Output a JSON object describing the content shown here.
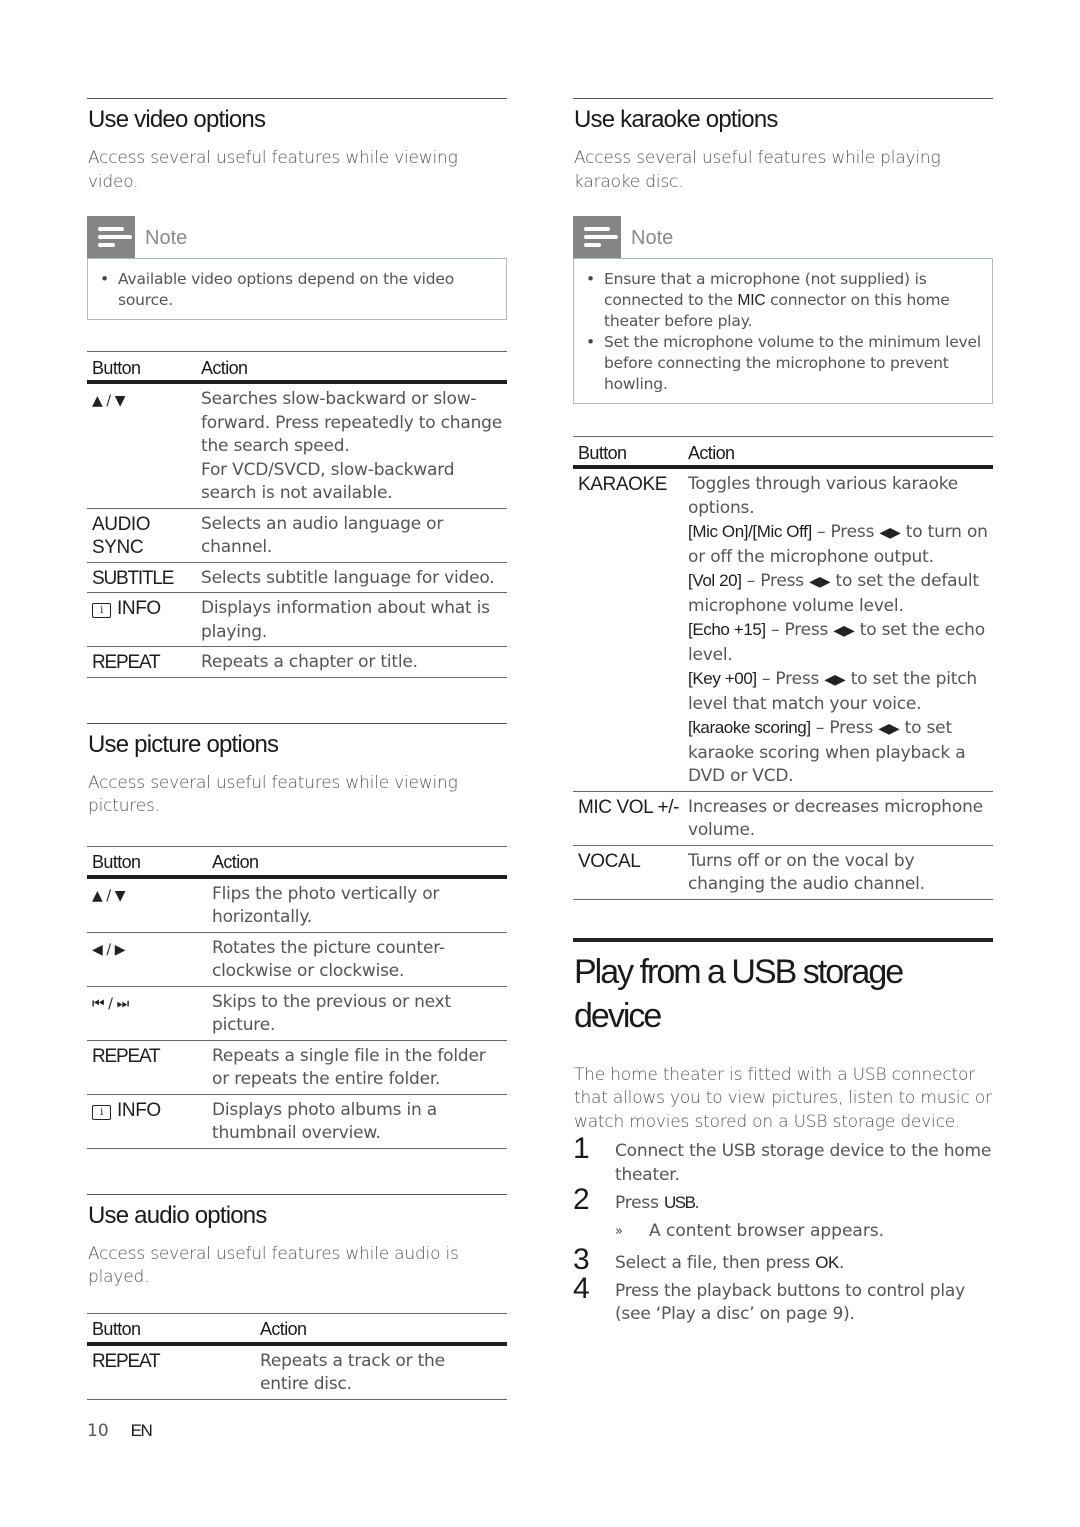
{
  "video": {
    "title": "Use video options",
    "intro": "Access several useful features while viewing video.",
    "note_label": "Note",
    "notes": [
      "Available video options depend on the video source."
    ],
    "table": {
      "headers": [
        "Button",
        "Action"
      ],
      "rows": [
        {
          "button": "▲ / ▼",
          "action": "Searches slow-backward or slow-forward. Press repeatedly to change the search speed.",
          "action2": "For VCD/SVCD, slow-backward search is not available."
        },
        {
          "button": "AUDIO SYNC",
          "action": "Selects an audio language or channel."
        },
        {
          "button": "SUBTITLE",
          "action": "Selects subtitle language for video."
        },
        {
          "button": "INFO",
          "icon": "info-icon",
          "action": "Displays information about what is playing."
        },
        {
          "button": "REPEAT",
          "action": "Repeats a chapter or title."
        }
      ]
    }
  },
  "picture": {
    "title": "Use picture options",
    "intro": "Access several useful features while viewing pictures.",
    "table": {
      "headers": [
        "Button",
        "Action"
      ],
      "rows": [
        {
          "button": "▲ / ▼",
          "action": "Flips the photo vertically or horizontally."
        },
        {
          "button": "◀ / ▶",
          "action": "Rotates the picture counter-clockwise or clockwise."
        },
        {
          "button": "⏮ / ⏭",
          "action": "Skips to the previous or next picture."
        },
        {
          "button": "REPEAT",
          "action": "Repeats a single file in the folder or repeats the entire folder."
        },
        {
          "button": "INFO",
          "icon": "info-icon",
          "action": "Displays photo albums in a thumbnail overview."
        }
      ]
    }
  },
  "audio": {
    "title": "Use audio options",
    "intro": "Access several useful features while audio is played.",
    "table": {
      "headers": [
        "Button",
        "Action"
      ],
      "rows": [
        {
          "button": "REPEAT",
          "action": "Repeats a track or the entire disc."
        }
      ]
    }
  },
  "karaoke": {
    "title": "Use karaoke options",
    "intro": "Access several useful features while playing karaoke disc.",
    "note_label": "Note",
    "notes": [
      {
        "pre": "Ensure that a microphone (not supplied) is connected to the ",
        "term": "MIC",
        "post": " connector on this home theater before play."
      },
      {
        "text": "Set the microphone volume to the minimum level before connecting the microphone to prevent howling."
      }
    ],
    "table": {
      "headers": [
        "Button",
        "Action"
      ],
      "rows": [
        {
          "button": "KARAOKE",
          "action": "Toggles through various karaoke options.",
          "options": [
            {
              "term": "[Mic On]/[Mic Off]",
              "arrows": "◀▶",
              "pre": " – Press ",
              "post": " to turn on or off the microphone output."
            },
            {
              "term": "[Vol 20]",
              "arrows": "◀▶",
              "pre": " – Press ",
              "post": " to set the default microphone volume level."
            },
            {
              "term": "[Echo +15]",
              "arrows": "◀▶",
              "pre": " – Press ",
              "post": " to set the echo level."
            },
            {
              "term": "[Key +00]",
              "arrows": "◀▶",
              "pre": " – Press ",
              "post": " to set the pitch level that match your voice."
            },
            {
              "term": "[karaoke scoring]",
              "arrows": "◀▶",
              "pre": " – Press ",
              "post": " to set karaoke scoring when playback a DVD or VCD."
            }
          ]
        },
        {
          "button": "MIC VOL +/-",
          "action": "Increases or decreases microphone volume."
        },
        {
          "button": "VOCAL",
          "action": "Turns off or on the vocal by changing the audio channel."
        }
      ]
    }
  },
  "usb": {
    "title": "Play from a USB storage device",
    "intro": "The home theater is fitted with a USB connector that allows you to view pictures, listen to music or watch movies stored on a USB storage device.",
    "steps": [
      {
        "num": "1",
        "text": "Connect the USB storage device to the home theater."
      },
      {
        "num": "2",
        "pre": "Press ",
        "term": "USB",
        "post": ".",
        "result_mark": "»",
        "result": "A content browser appears."
      },
      {
        "num": "3",
        "pre": "Select a file, then press ",
        "term": "OK",
        "post": "."
      },
      {
        "num": "4",
        "text": "Press the playback buttons to control play (see ‘Play a disc’ on page 9)."
      }
    ]
  },
  "footer": {
    "page": "10",
    "lang": "EN"
  }
}
